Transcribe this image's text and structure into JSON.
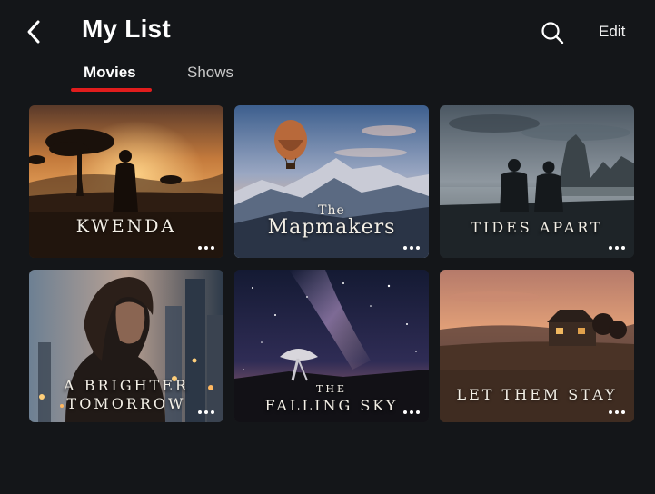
{
  "header": {
    "title": "My List",
    "edit_label": "Edit",
    "back_icon": "chevron-left-icon",
    "search_icon": "search-icon"
  },
  "tabs": [
    {
      "label": "Movies",
      "selected": true
    },
    {
      "label": "Shows",
      "selected": false
    }
  ],
  "accent_color": "#e11d1d",
  "cards": [
    {
      "title": "KWENDA"
    },
    {
      "title_small": "The",
      "title_large": "Mapmakers"
    },
    {
      "title": "TIDES APART"
    },
    {
      "title_line1": "A BRIGHTER",
      "title_line2": "TOMORROW"
    },
    {
      "title_small": "THE",
      "title_large": "FALLING SKY"
    },
    {
      "title": "LET THEM STAY"
    }
  ],
  "more_icon": "more-horizontal-icon"
}
